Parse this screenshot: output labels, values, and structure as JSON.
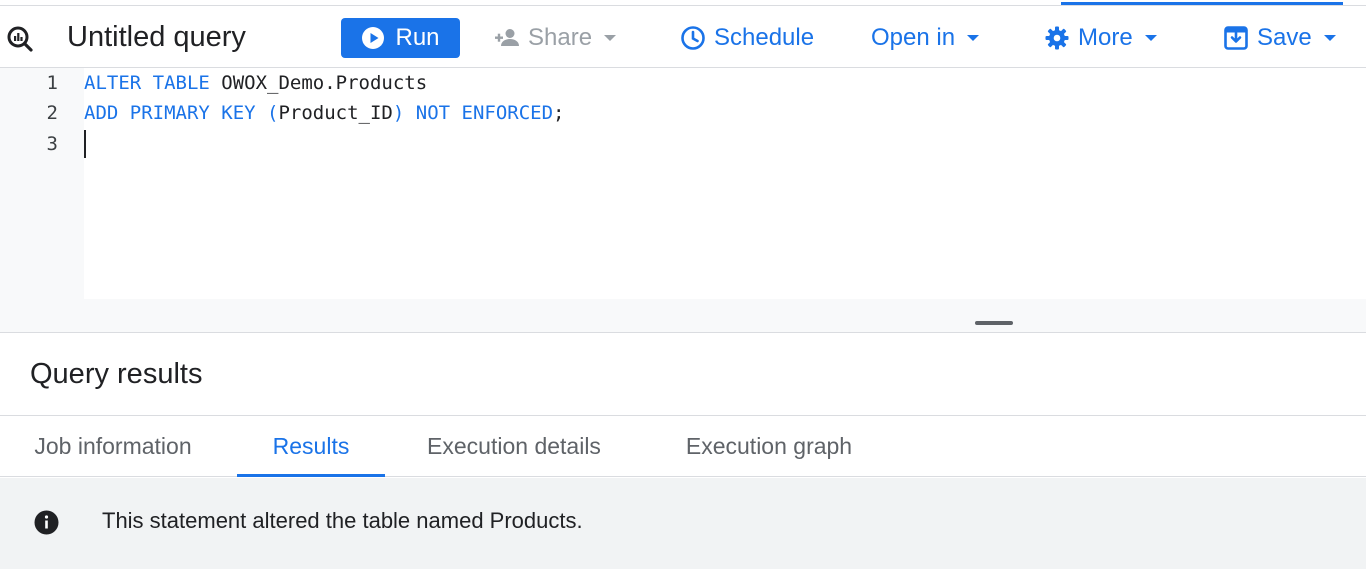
{
  "toolbar": {
    "title": "Untitled query",
    "run_label": "Run",
    "share_label": "Share",
    "schedule_label": "Schedule",
    "open_in_label": "Open in",
    "more_label": "More",
    "save_label": "Save"
  },
  "editor": {
    "line_numbers": [
      "1",
      "2",
      "3"
    ],
    "lines": [
      [
        {
          "t": "ALTER TABLE",
          "kw": true
        },
        {
          "t": " OWOX_Demo.Products",
          "kw": false
        }
      ],
      [
        {
          "t": "ADD PRIMARY KEY",
          "kw": true
        },
        {
          "t": " (",
          "kw": true
        },
        {
          "t": "Product_ID",
          "kw": false
        },
        {
          "t": ")",
          "kw": true
        },
        {
          "t": " NOT ENFORCED",
          "kw": true
        },
        {
          "t": ";",
          "kw": false
        }
      ],
      []
    ]
  },
  "results": {
    "title": "Query results",
    "tabs": [
      {
        "label": "Job information",
        "active": false
      },
      {
        "label": "Results",
        "active": true
      },
      {
        "label": "Execution details",
        "active": false
      },
      {
        "label": "Execution graph",
        "active": false
      }
    ],
    "message": "This statement altered the table named Products."
  },
  "icons": {
    "title_icon": "query-icon",
    "run_icon": "play-icon",
    "share_icon": "person-add-icon",
    "schedule_icon": "clock-icon",
    "more_icon": "gear-icon",
    "save_icon": "save-icon",
    "info_icon": "info-icon"
  },
  "colors": {
    "accent": "#1a73e8",
    "disabled": "#9aa0a6",
    "panel_bg": "#f1f3f4"
  }
}
